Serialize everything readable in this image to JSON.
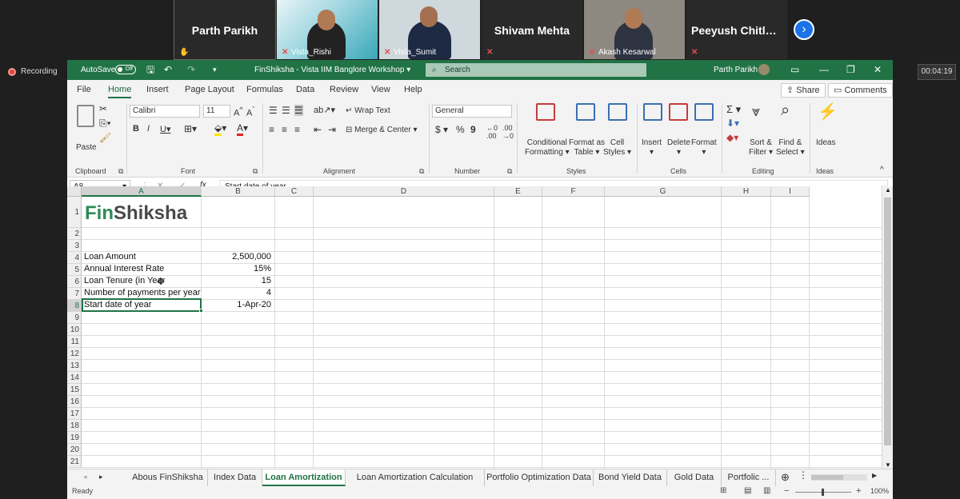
{
  "meeting": {
    "tiles": [
      {
        "name": "Parth Parikh",
        "type": "name-only"
      },
      {
        "name": "Vista_Rishi",
        "type": "video"
      },
      {
        "name": "Vista_Sumit",
        "type": "video"
      },
      {
        "name": "Shivam Mehta",
        "type": "name-only"
      },
      {
        "name": "Akash Kesarwal",
        "type": "video"
      },
      {
        "name": "Peeyush  Chitlan...",
        "type": "name-only"
      }
    ],
    "recording_label": "Recording",
    "timer": "00:04:19",
    "next_icon": "chevron-right-icon"
  },
  "excel": {
    "autosave_label": "AutoSave",
    "autosave_state": "Off",
    "file_title": "FinShiksha - Vista IIM Banglore Workshop",
    "search_placeholder": "Search",
    "user_name": "Parth Parikh",
    "menu_tabs": [
      "File",
      "Home",
      "Insert",
      "Page Layout",
      "Formulas",
      "Data",
      "Review",
      "View",
      "Help"
    ],
    "active_tab": "Home",
    "share_label": "Share",
    "comments_label": "Comments",
    "ribbon": {
      "paste": "Paste",
      "font_name": "Calibri",
      "font_size": "11",
      "wrap_text": "Wrap Text",
      "merge_center": "Merge & Center",
      "number_format": "General",
      "conditional_formatting": [
        "Conditional",
        "Formatting"
      ],
      "format_as_table": [
        "Format as",
        "Table"
      ],
      "cell_styles": [
        "Cell",
        "Styles"
      ],
      "insert": "Insert",
      "delete": "Delete",
      "format": "Format",
      "sort_filter": [
        "Sort &",
        "Filter"
      ],
      "find_select": [
        "Find &",
        "Select"
      ],
      "ideas": "Ideas",
      "groups": [
        "Clipboard",
        "Font",
        "Alignment",
        "Number",
        "Styles",
        "Cells",
        "Editing",
        "Ideas"
      ]
    },
    "name_box": "A8",
    "formula": "Start date of year",
    "columns": [
      "A",
      "B",
      "C",
      "D",
      "E",
      "F",
      "G",
      "H",
      "I"
    ],
    "rows": [
      "1",
      "2",
      "3",
      "4",
      "5",
      "6",
      "7",
      "8",
      "9",
      "10",
      "11",
      "12",
      "13",
      "14",
      "15",
      "16",
      "17",
      "18",
      "19",
      "20",
      "21"
    ],
    "logo": {
      "part1": "Fin",
      "part2": "Shiksha",
      "color1": "#2e8b57",
      "color2": "#4a4a4a"
    },
    "cells": {
      "A4": "Loan Amount",
      "B4": "2,500,000",
      "A5": "Annual Interest Rate",
      "B5": "15%",
      "A6": "Loan Tenure (in Year",
      "B6": "15",
      "A7": "Number of payments per year",
      "B7": "4",
      "A8": "Start date of year",
      "B8": "1-Apr-20"
    },
    "selected_cell": "A8",
    "sheets": [
      "Abous FinShiksha",
      "Index Data",
      "Loan Amortization",
      "Loan Amortization Calculation",
      "Portfolio Optimization Data",
      "Bond Yield Data",
      "Gold Data",
      "Portfolic ..."
    ],
    "active_sheet": "Loan Amortization",
    "status": "Ready",
    "zoom": "100%",
    "accent_color": "#217346"
  }
}
